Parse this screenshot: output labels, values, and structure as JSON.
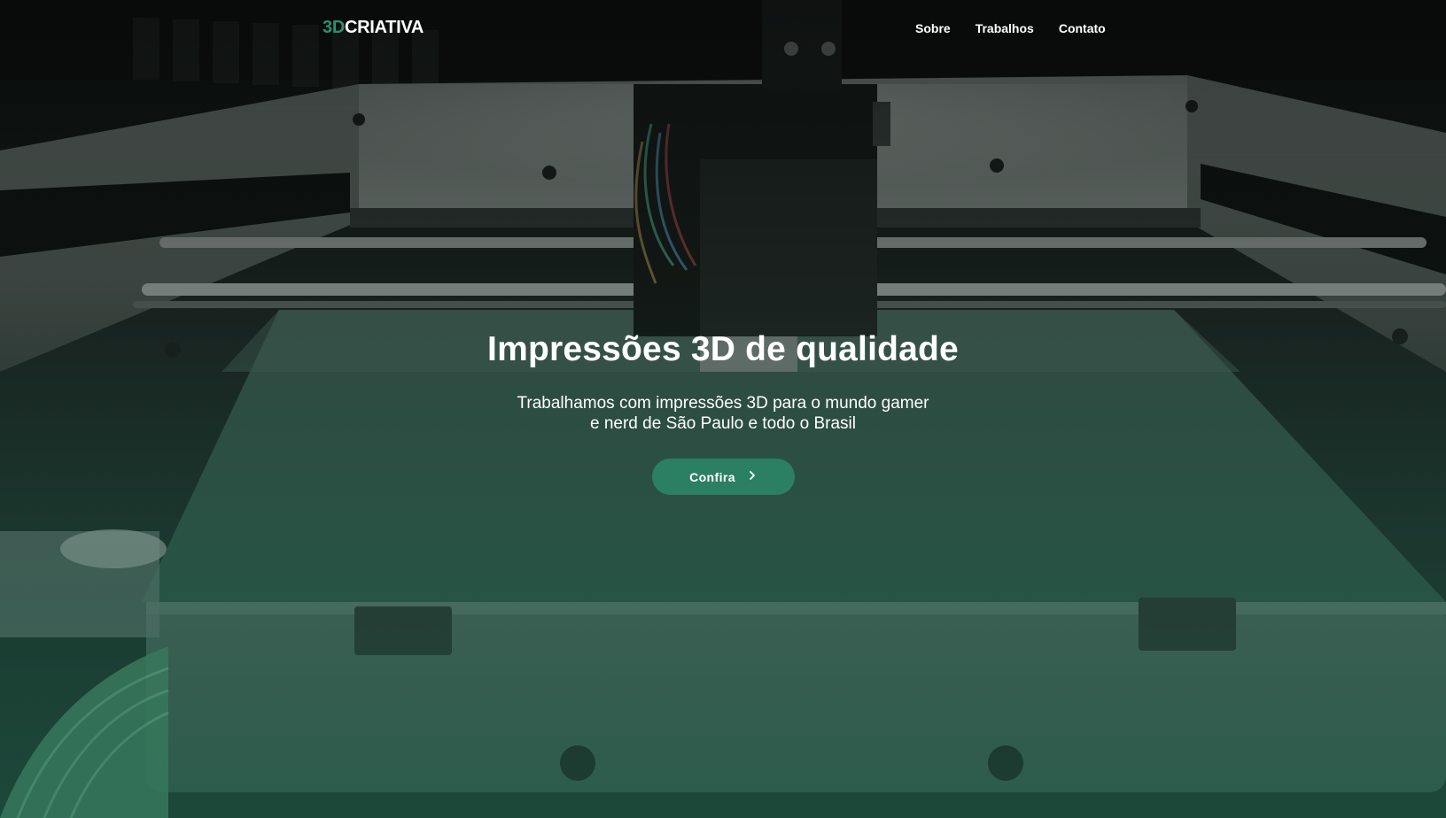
{
  "brand": {
    "accent_part": "3D",
    "main_part": "CRIATIVA",
    "accent_color": "#2f8f6e"
  },
  "nav": {
    "items": [
      {
        "label": "Sobre"
      },
      {
        "label": "Trabalhos"
      },
      {
        "label": "Contato"
      }
    ]
  },
  "hero": {
    "title": "Impressões 3D de qualidade",
    "subtitle_line1": "Trabalhamos com impressões 3D para o mundo gamer",
    "subtitle_line2": "e nerd de São Paulo e todo o Brasil",
    "cta_label": "Confira",
    "cta_icon": "chevron-right-icon",
    "cta_color": "#2b8064",
    "background": "3d-printer-photo"
  }
}
